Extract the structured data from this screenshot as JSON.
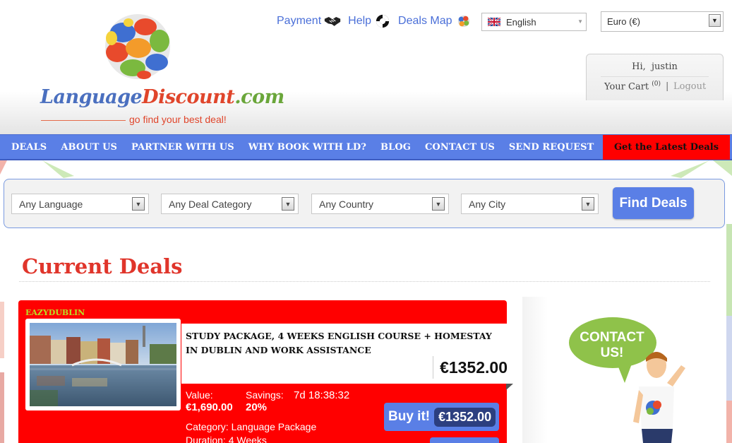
{
  "logo": {
    "part1": "Language",
    "part2": "Discount",
    "part3": ".com",
    "tagline": "go find your best deal!"
  },
  "toplinks": {
    "payment": "Payment",
    "help": "Help",
    "deals_map": "Deals Map"
  },
  "language_select": {
    "value": "English"
  },
  "currency_select": {
    "value": "Euro (€)"
  },
  "user": {
    "greeting": "Hi,",
    "name": "justin",
    "cart_label": "Your Cart",
    "cart_count": "(0)",
    "separator": "|",
    "logout": "Logout"
  },
  "nav": {
    "items": [
      "DEALS",
      "ABOUT US",
      "PARTNER WITH US",
      "WHY BOOK WITH LD?",
      "BLOG",
      "CONTACT US",
      "SEND REQUEST"
    ],
    "cta": "Get the Latest Deals"
  },
  "search": {
    "language": "Any Language",
    "category": "Any Deal Category",
    "country": "Any Country",
    "city": "Any City",
    "button": "Find Deals"
  },
  "main": {
    "heading": "Current Deals"
  },
  "deal": {
    "provider": "EAZYDUBLIN",
    "title": "Study Package, 4 weeks English Course + Homestay in Dublin and Work Assistance",
    "price": "€1352.00",
    "value_label": "Value:",
    "value": "€1,690.00",
    "savings_label": "Savings:",
    "savings": "20%",
    "countdown": "7d 18:38:32",
    "buy_label": "Buy it!",
    "buy_price": "€1352.00",
    "category_line": "Category: Language Package",
    "duration_line": "Duration: 4 Weeks"
  },
  "sidebar": {
    "contact_bubble": "CONTACT US!"
  },
  "colors": {
    "nav_blue": "#5a7fe6",
    "deal_red": "#ff0000",
    "heading_red": "#e0352b",
    "provider_green": "#b8e025"
  }
}
